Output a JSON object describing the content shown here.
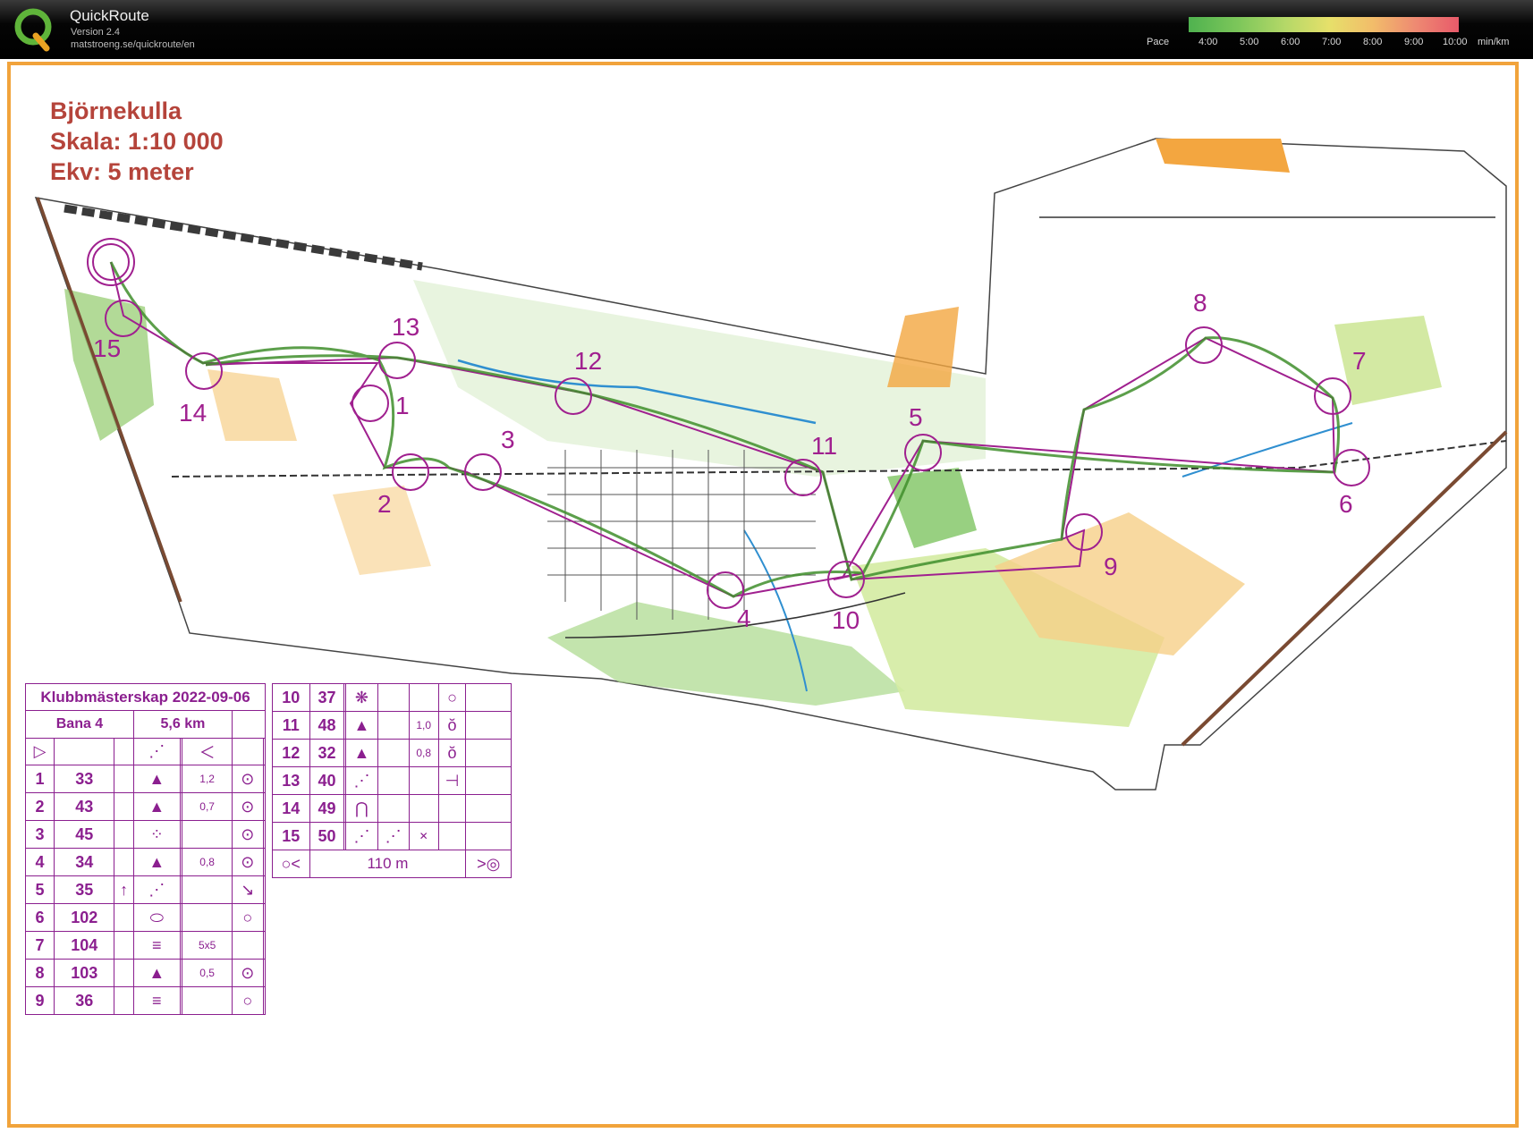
{
  "app": {
    "name": "QuickRoute",
    "version": "Version 2.4",
    "url": "matstroeng.se/quickroute/en",
    "logo_letter": "Q"
  },
  "pace_legend": {
    "label": "Pace",
    "ticks": [
      "4:00",
      "5:00",
      "6:00",
      "7:00",
      "8:00",
      "9:00",
      "10:00"
    ],
    "unit": "min/km",
    "colors": [
      "#4fb24f",
      "#b5d868",
      "#e6e06a",
      "#f2bd6a",
      "#e85a6a"
    ]
  },
  "map": {
    "title_lines": [
      "Björnekulla",
      "Skala: 1:10 000",
      "Ekv: 5 meter"
    ],
    "colors": {
      "course": "#a0208f",
      "route": "#3f8e2c",
      "green": "#74c14f",
      "yellow": "#f6cf88",
      "frame": "#f1a33b"
    },
    "control_labels": [
      "1",
      "2",
      "3",
      "4",
      "5",
      "6",
      "7",
      "8",
      "9",
      "10",
      "11",
      "12",
      "13",
      "14",
      "15"
    ]
  },
  "control_card": {
    "event": "Klubbmästerskap 2022-09-06",
    "course": "Bana 4",
    "length": "5,6 km",
    "start_symbols": [
      "▷",
      "⋰",
      "＜"
    ],
    "rows_left": [
      {
        "num": "1",
        "code": "33",
        "c": "",
        "d": "▲",
        "e": "",
        "f": "1,2",
        "g": "⊙"
      },
      {
        "num": "2",
        "code": "43",
        "c": "",
        "d": "▲",
        "e": "",
        "f": "0,7",
        "g": "⊙"
      },
      {
        "num": "3",
        "code": "45",
        "c": "",
        "d": "⁘",
        "e": "",
        "f": "",
        "g": "⊙"
      },
      {
        "num": "4",
        "code": "34",
        "c": "",
        "d": "▲",
        "e": "",
        "f": "0,8",
        "g": "⊙"
      },
      {
        "num": "5",
        "code": "35",
        "c": "↑",
        "d": "⋰",
        "e": "",
        "f": "",
        "g": "↘"
      },
      {
        "num": "6",
        "code": "102",
        "c": "",
        "d": "⬭",
        "e": "",
        "f": "",
        "g": "○"
      },
      {
        "num": "7",
        "code": "104",
        "c": "",
        "d": "≡",
        "e": "",
        "f": "5x5",
        "g": ""
      },
      {
        "num": "8",
        "code": "103",
        "c": "",
        "d": "▲",
        "e": "",
        "f": "0,5",
        "g": "⊙"
      },
      {
        "num": "9",
        "code": "36",
        "c": "",
        "d": "≡",
        "e": "",
        "f": "",
        "g": "○"
      }
    ],
    "rows_right": [
      {
        "num": "10",
        "code": "37",
        "c": "",
        "d": "❋",
        "e": "",
        "f": "",
        "g": "○"
      },
      {
        "num": "11",
        "code": "48",
        "c": "",
        "d": "▲",
        "e": "",
        "f": "1,0",
        "g": "ŏ"
      },
      {
        "num": "12",
        "code": "32",
        "c": "",
        "d": "▲",
        "e": "",
        "f": "0,8",
        "g": "ŏ"
      },
      {
        "num": "13",
        "code": "40",
        "c": "",
        "d": "⋰",
        "e": "",
        "f": "",
        "g": "⊣"
      },
      {
        "num": "14",
        "code": "49",
        "c": "",
        "d": "⋂",
        "e": "",
        "f": "",
        "g": ""
      },
      {
        "num": "15",
        "code": "50",
        "c": "",
        "d": "⋰",
        "e": "⋰",
        "f": "✕",
        "g": ""
      }
    ],
    "finish": {
      "distance": "110 m",
      "left_symbol": "○<",
      "right_symbol": ">◎"
    }
  }
}
